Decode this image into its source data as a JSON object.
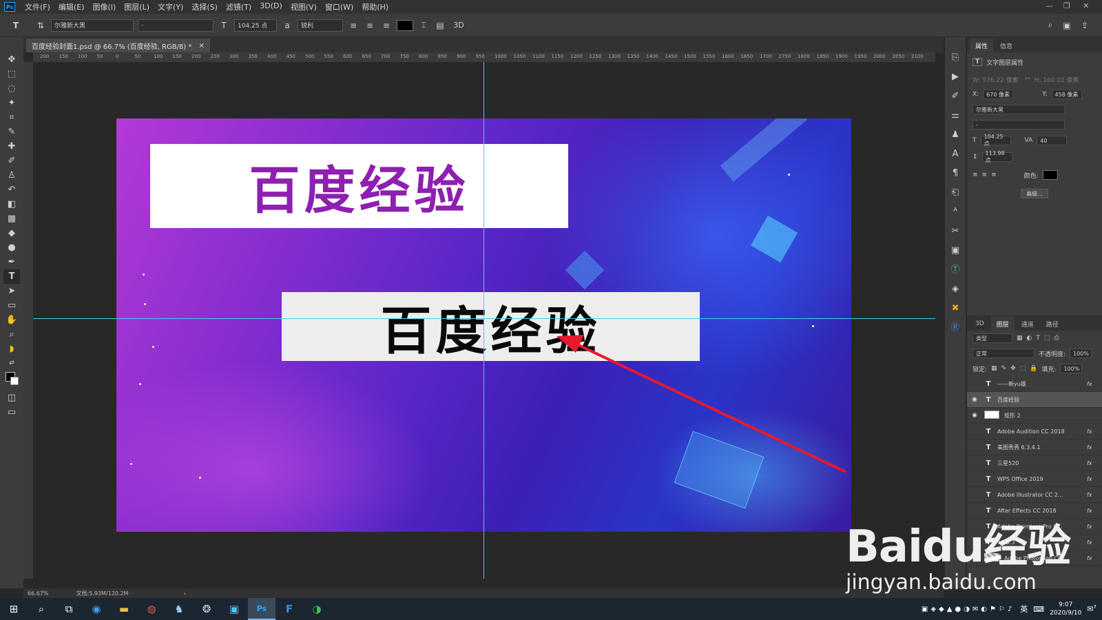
{
  "app": {
    "logo": "Ps"
  },
  "menu": [
    "文件(F)",
    "编辑(E)",
    "图像(I)",
    "图层(L)",
    "文字(Y)",
    "选择(S)",
    "滤镜(T)",
    "3D(D)",
    "视图(V)",
    "窗口(W)",
    "帮助(H)"
  ],
  "options": {
    "font_family": "尔雅新大黑",
    "font_style": "-",
    "font_size": "104.25 点",
    "antialias": "锐利",
    "mode_3d": "3D"
  },
  "document": {
    "tab_title": "百度经验封面1.psd @ 66.7% (百度经验, RGB/8) *",
    "close": "×"
  },
  "ruler_h": [
    "200",
    "150",
    "100",
    "50",
    "0",
    "50",
    "100",
    "150",
    "200",
    "250",
    "300",
    "350",
    "400",
    "450",
    "500",
    "550",
    "600",
    "650",
    "700",
    "750",
    "800",
    "850",
    "900",
    "950",
    "1000",
    "1050",
    "1100",
    "1150",
    "1200",
    "1250",
    "1300",
    "1350",
    "1400",
    "1450",
    "1500",
    "1550",
    "1600",
    "1650",
    "1700",
    "1750",
    "1800",
    "1850",
    "1900",
    "1950",
    "2000",
    "2050",
    "2100"
  ],
  "canvas": {
    "banner1_text": "百度经验",
    "banner2_text": "百度经验",
    "arrow_color": "#e8192c",
    "guide_color": "#39d4e8"
  },
  "status": {
    "zoom": "66.67%",
    "doc_info": "文档:5.93M/120.2M",
    "next": "›"
  },
  "properties": {
    "tabs": [
      "属性",
      "信息"
    ],
    "header": "文字图层属性",
    "w": "W: 576.22 像素",
    "h": "H: 160.02 像素",
    "x_label": "X:",
    "x": "670 像素",
    "y_label": "Y:",
    "y": "458 像素",
    "font_family": "尔雅新大黑",
    "font_style": "-",
    "size": "104.25 点",
    "tracking": "40",
    "leading": "113.98 点",
    "color_label": "颜色:",
    "advanced": "高级..."
  },
  "layers_panel": {
    "tabs": [
      "3D",
      "图层",
      "通道",
      "路径"
    ],
    "filter": "类型",
    "blend": "正常",
    "opacity_label": "不透明度:",
    "opacity": "100%",
    "lock_label": "锁定:",
    "fill_label": "填充:",
    "fill": "100%",
    "layers": [
      {
        "name": "——新yu雄",
        "type": "T",
        "visible": false,
        "fx": "fx"
      },
      {
        "name": "百度经验",
        "type": "T",
        "visible": true,
        "fx": "",
        "selected": true
      },
      {
        "name": "矩形 2",
        "type": "shape",
        "visible": true,
        "fx": ""
      },
      {
        "name": "Adobe Audition CC 2018",
        "type": "T",
        "visible": false,
        "fx": "fx"
      },
      {
        "name": "美图秀秀 6.3.4.1",
        "type": "T",
        "visible": false,
        "fx": "fx"
      },
      {
        "name": "三星520",
        "type": "T",
        "visible": false,
        "fx": "fx"
      },
      {
        "name": "WPS Office 2019",
        "type": "T",
        "visible": false,
        "fx": "fx"
      },
      {
        "name": "Adobe Illustrator CC 2...",
        "type": "T",
        "visible": false,
        "fx": "fx"
      },
      {
        "name": "After Effects CC 2018",
        "type": "T",
        "visible": false,
        "fx": "fx"
      },
      {
        "name": "Adobe Premiere Pro C...",
        "type": "T",
        "visible": false,
        "fx": "fx"
      },
      {
        "name": "10.5.3",
        "type": "T",
        "visible": false,
        "fx": "fx"
      },
      {
        "name": "Adobe Photoshop CC ...",
        "type": "img",
        "visible": false,
        "fx": "fx"
      }
    ]
  },
  "taskbar": {
    "time": "9:07",
    "date": "2020/9/10",
    "ime": "英",
    "notif": "7"
  },
  "watermark": {
    "main": "Baidu经验",
    "sub": "jingyan.baidu.com"
  }
}
